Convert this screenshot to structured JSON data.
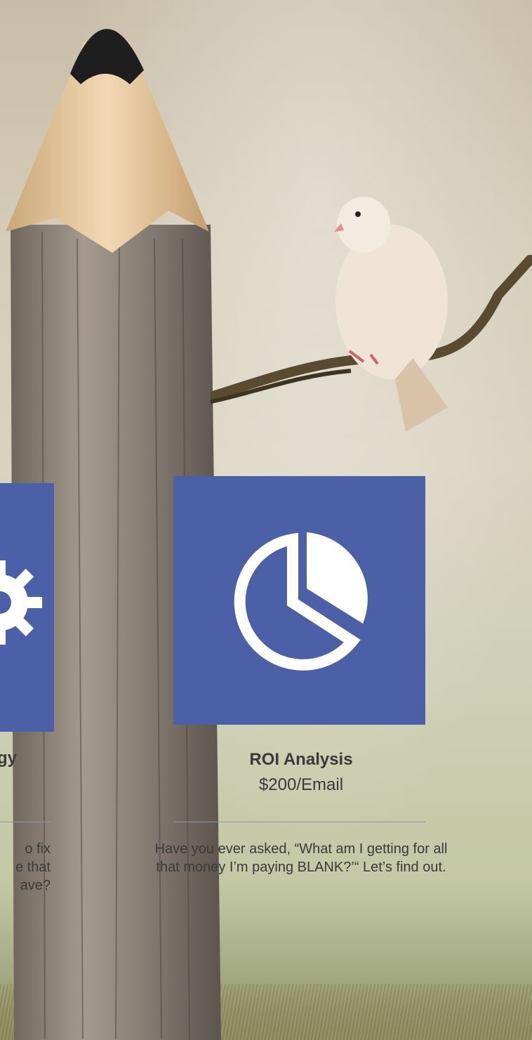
{
  "services": [
    {
      "title": "ROI Analysis",
      "price": "$200/Email",
      "description": "Have you ever asked, “What am I getting for all that money I’m paying BLANK?’“ Let’s find out.",
      "icon": "pie-chart-icon"
    }
  ],
  "partial_left_card": {
    "title_fragment": "gy",
    "desc_line1": "o fix",
    "desc_line2": "e that",
    "desc_line3": "ave?",
    "icon": "gear-icon"
  },
  "colors": {
    "card_blue": "#4b60a6",
    "text": "#3a3a3a",
    "divider": "#8f9aa6"
  }
}
